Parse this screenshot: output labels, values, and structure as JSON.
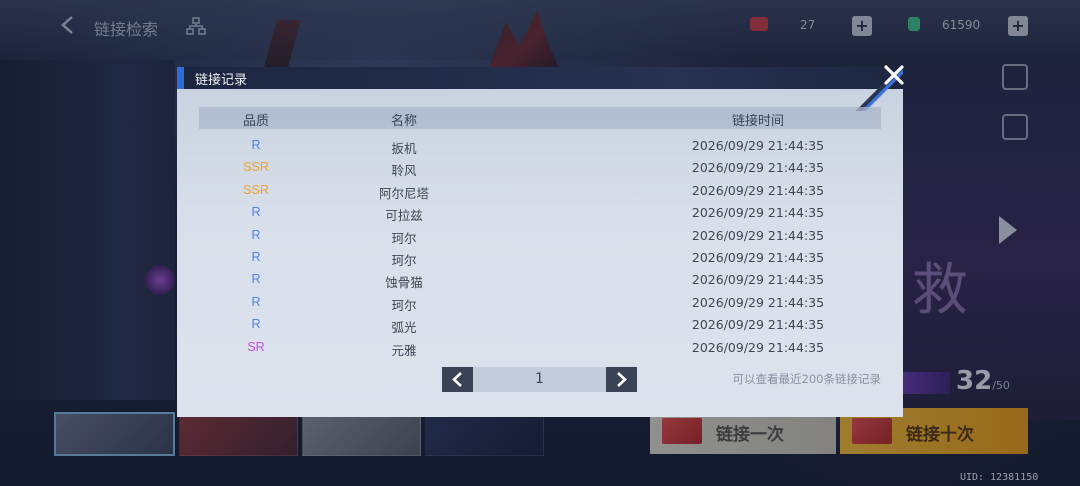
{
  "topbar": {
    "title": "链接检索",
    "resource1": "27",
    "resource2": "61590"
  },
  "side": {
    "btn1_label": "",
    "btn2_label": ""
  },
  "bottom": {
    "counter_label": "",
    "counter_value": "32",
    "counter_max": "/50",
    "link_once": "链接一次",
    "link_ten": "链接十次",
    "uid": "UID: 12381150"
  },
  "modal": {
    "title": "链接记录",
    "columns": {
      "quality": "品质",
      "name": "名称",
      "time": "链接时间"
    },
    "records": [
      {
        "quality": "R",
        "name": "扳机",
        "time": "2026/09/29 21:44:35"
      },
      {
        "quality": "SSR",
        "name": "聆风",
        "time": "2026/09/29 21:44:35"
      },
      {
        "quality": "SSR",
        "name": "阿尔尼塔",
        "time": "2026/09/29 21:44:35"
      },
      {
        "quality": "R",
        "name": "可拉兹",
        "time": "2026/09/29 21:44:35"
      },
      {
        "quality": "R",
        "name": "珂尔",
        "time": "2026/09/29 21:44:35"
      },
      {
        "quality": "R",
        "name": "珂尔",
        "time": "2026/09/29 21:44:35"
      },
      {
        "quality": "R",
        "name": "蚀骨猫",
        "time": "2026/09/29 21:44:35"
      },
      {
        "quality": "R",
        "name": "珂尔",
        "time": "2026/09/29 21:44:35"
      },
      {
        "quality": "R",
        "name": "弧光",
        "time": "2026/09/29 21:44:35"
      },
      {
        "quality": "SR",
        "name": "元雅",
        "time": "2026/09/29 21:44:35"
      }
    ],
    "page": "1",
    "hint": "可以查看最近200条链接记录"
  },
  "colors": {
    "quality_R": "#4a86e8",
    "quality_SR": "#c04fd8",
    "quality_SSR": "#f0a030",
    "accent": "#2f6cd8"
  },
  "icons": {
    "back": "chevron-left-icon",
    "tree": "hierarchy-icon",
    "close": "close-icon",
    "prev": "chevron-left-icon",
    "next": "chevron-right-icon"
  }
}
